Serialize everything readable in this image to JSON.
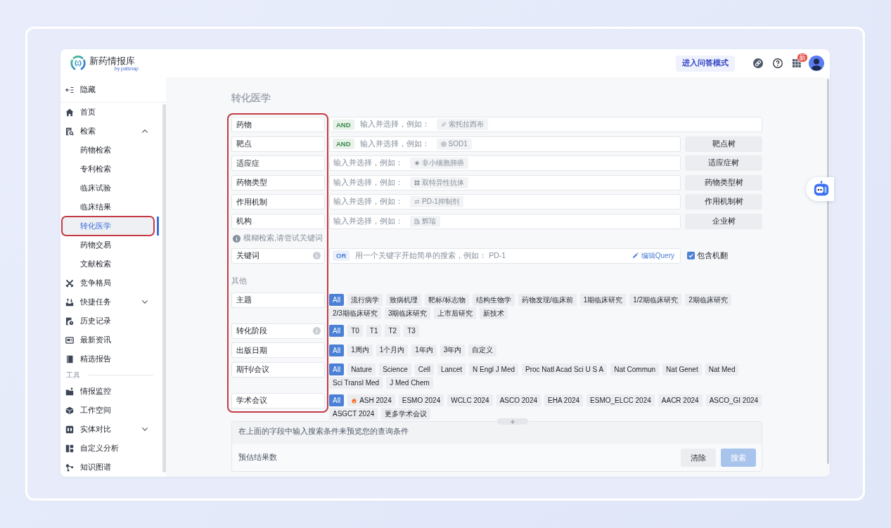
{
  "app": {
    "name": "新药情报库",
    "byline": "by patsnap"
  },
  "header": {
    "qa_button": "进入问答模式",
    "apps_badge": "新"
  },
  "sidebar": {
    "collapse_label": "隐藏",
    "sections": [
      {
        "items": [
          {
            "label": "首页",
            "kind": "link",
            "selected": false
          },
          {
            "label": "检索",
            "kind": "group",
            "selected": false,
            "expanded": true,
            "children": [
              {
                "label": "药物检索",
                "selected": false
              },
              {
                "label": "专利检索",
                "selected": false
              },
              {
                "label": "临床试验",
                "selected": false
              },
              {
                "label": "临床结果",
                "selected": false
              },
              {
                "label": "转化医学",
                "selected": true
              },
              {
                "label": "药物交易",
                "selected": false
              },
              {
                "label": "文献检索",
                "selected": false
              }
            ]
          },
          {
            "label": "竞争格局",
            "kind": "link",
            "selected": false
          },
          {
            "label": "快捷任务",
            "kind": "group",
            "selected": false,
            "expanded": false
          },
          {
            "label": "历史记录",
            "kind": "link",
            "selected": false
          },
          {
            "label": "最新资讯",
            "kind": "link",
            "selected": false
          },
          {
            "label": "精选报告",
            "kind": "link",
            "selected": false
          }
        ]
      },
      {
        "title": "工具",
        "items": [
          {
            "label": "情报监控",
            "kind": "link",
            "selected": false
          },
          {
            "label": "工作空间",
            "kind": "link",
            "selected": false
          },
          {
            "label": "实体对比",
            "kind": "group",
            "selected": false,
            "expanded": false
          },
          {
            "label": "自定义分析",
            "kind": "link",
            "selected": false
          },
          {
            "label": "知识图谱",
            "kind": "link",
            "selected": false
          }
        ]
      }
    ]
  },
  "page": {
    "title": "转化医学"
  },
  "fields": [
    {
      "label": "药物",
      "operator": {
        "label": "AND",
        "color": "#3b8a4c"
      },
      "placeholder": "输入并选择，例如：",
      "example": "索托拉西布"
    },
    {
      "label": "靶点",
      "operator": {
        "label": "AND",
        "color": "#3b8a4c"
      },
      "placeholder": "输入并选择，例如：",
      "example": "SOD1",
      "tree_button": "靶点树"
    },
    {
      "label": "适应症",
      "placeholder": "输入并选择，例如：",
      "example": "非小细胞肺癌",
      "tree_button": "适应症树"
    },
    {
      "label": "药物类型",
      "placeholder": "输入并选择，例如：",
      "example": "双特异性抗体",
      "tree_button": "药物类型树"
    },
    {
      "label": "作用机制",
      "placeholder": "输入并选择，例如：",
      "example": "PD-1抑制剂",
      "tree_button": "作用机制树"
    },
    {
      "label": "机构",
      "placeholder": "输入并选择，例如：",
      "example": "辉瑞",
      "tree_button": "企业树"
    }
  ],
  "hint": "模糊检索,请尝试关键词",
  "keyword": {
    "label": "关键词",
    "info_icon": true,
    "operator": {
      "label": "OR",
      "color": "#4a7fd6"
    },
    "placeholder": "用一个关键字开始简单的搜索，例如： PD-1",
    "edit_link": "编辑Query",
    "checkbox": {
      "label": "包含机翻",
      "checked": true
    }
  },
  "other_title": "其他",
  "filters": [
    {
      "label": "主题",
      "info_icon": false,
      "options": [
        {
          "label": "All",
          "selected": true
        },
        {
          "label": "流行病学",
          "selected": false
        },
        {
          "label": "致病机理",
          "selected": false
        },
        {
          "label": "靶标/标志物",
          "selected": false
        },
        {
          "label": "结构生物学",
          "selected": false
        },
        {
          "label": "药物发现/临床前",
          "selected": false
        },
        {
          "label": "1期临床研究",
          "selected": false
        },
        {
          "label": "1/2期临床研究",
          "selected": false
        },
        {
          "label": "2期临床研究",
          "selected": false
        },
        {
          "label": "2/3期临床研究",
          "selected": false
        },
        {
          "label": "3期临床研究",
          "selected": false
        },
        {
          "label": "上市后研究",
          "selected": false
        },
        {
          "label": "新技术",
          "selected": false
        }
      ]
    },
    {
      "label": "转化阶段",
      "info_icon": true,
      "options": [
        {
          "label": "All",
          "selected": true
        },
        {
          "label": "T0",
          "selected": false
        },
        {
          "label": "T1",
          "selected": false
        },
        {
          "label": "T2",
          "selected": false
        },
        {
          "label": "T3",
          "selected": false
        }
      ]
    },
    {
      "label": "出版日期",
      "info_icon": false,
      "options": [
        {
          "label": "All",
          "selected": true
        },
        {
          "label": "1周内",
          "selected": false
        },
        {
          "label": "1个月内",
          "selected": false
        },
        {
          "label": "1年内",
          "selected": false
        },
        {
          "label": "3年内",
          "selected": false
        },
        {
          "label": "自定义",
          "selected": false
        }
      ]
    },
    {
      "label": "期刊/会议",
      "info_icon": false,
      "options": [
        {
          "label": "All",
          "selected": true
        },
        {
          "label": "Nature",
          "selected": false
        },
        {
          "label": "Science",
          "selected": false
        },
        {
          "label": "Cell",
          "selected": false
        },
        {
          "label": "Lancet",
          "selected": false
        },
        {
          "label": "N Engl J Med",
          "selected": false
        },
        {
          "label": "Proc Natl Acad Sci U S A",
          "selected": false
        },
        {
          "label": "Nat Commun",
          "selected": false
        },
        {
          "label": "Nat Genet",
          "selected": false
        },
        {
          "label": "Nat Med",
          "selected": false
        },
        {
          "label": "Sci Transl Med",
          "selected": false
        },
        {
          "label": "J Med Chem",
          "selected": false
        }
      ]
    },
    {
      "label": "学术会议",
      "info_icon": false,
      "options": [
        {
          "label": "All",
          "selected": true,
          "hot": false
        },
        {
          "label": "ASH 2024",
          "selected": false,
          "hot": true
        },
        {
          "label": "ESMO 2024",
          "selected": false,
          "hot": false
        },
        {
          "label": "WCLC 2024",
          "selected": false,
          "hot": false
        },
        {
          "label": "ASCO 2024",
          "selected": false,
          "hot": false
        },
        {
          "label": "EHA 2024",
          "selected": false,
          "hot": false
        },
        {
          "label": "ESMO_ELCC 2024",
          "selected": false,
          "hot": false
        },
        {
          "label": "AACR 2024",
          "selected": false,
          "hot": false
        },
        {
          "label": "ASCO_GI 2024",
          "selected": false,
          "hot": false
        },
        {
          "label": "ASGCT 2024",
          "selected": false,
          "hot": false
        }
      ],
      "more": "更多学术会议"
    }
  ],
  "query_panel": {
    "placeholder": "在上面的字段中输入搜索条件来预览您的查询条件",
    "result_label": "预估结果数",
    "clear_button": "清除",
    "search_button": {
      "label": "搜索",
      "disabled": true
    }
  }
}
